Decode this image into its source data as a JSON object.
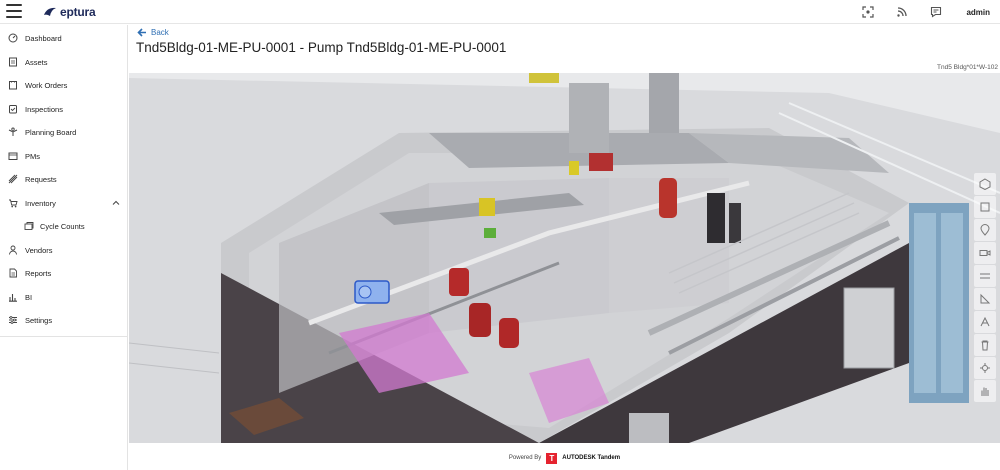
{
  "app": {
    "brand": "eptura",
    "user": "admin"
  },
  "header": {
    "icons": [
      "cursor-focus-icon",
      "rss-feed-icon",
      "chat-icon"
    ]
  },
  "sidebar": {
    "items": [
      {
        "label": "Dashboard",
        "icon": "dashboard-icon"
      },
      {
        "label": "Assets",
        "icon": "assets-icon"
      },
      {
        "label": "Work Orders",
        "icon": "work-orders-icon"
      },
      {
        "label": "Inspections",
        "icon": "inspections-icon"
      },
      {
        "label": "Planning Board",
        "icon": "planning-icon"
      },
      {
        "label": "PMs",
        "icon": "pms-icon"
      },
      {
        "label": "Requests",
        "icon": "requests-icon"
      },
      {
        "label": "Inventory",
        "icon": "inventory-icon",
        "expanded": true
      },
      {
        "label": "Cycle Counts",
        "icon": "cycle-counts-icon",
        "sub": true
      },
      {
        "label": "Vendors",
        "icon": "vendors-icon"
      },
      {
        "label": "Reports",
        "icon": "reports-icon"
      },
      {
        "label": "BI",
        "icon": "bi-icon"
      },
      {
        "label": "Settings",
        "icon": "settings-icon"
      }
    ]
  },
  "page": {
    "back_label": "Back",
    "title": "Tnd5Bldg-01-ME-PU-0001 - Pump Tnd5Bldg-01-ME-PU-0001",
    "model_label": "Tnd5 Bldg*01*W-102"
  },
  "viewer": {
    "tools": [
      "home-cube-icon",
      "box-icon",
      "pin-icon",
      "camera-icon",
      "section-icon",
      "measure-icon",
      "text-icon",
      "trash-icon",
      "settings-tool-icon",
      "hand-icon"
    ]
  },
  "footer": {
    "powered_by": "Powered By",
    "logo_letter": "T",
    "brand": "AUTODESK Tandem"
  },
  "colors": {
    "accent": "#2f6fb3",
    "tandem_red": "#e5232f"
  }
}
